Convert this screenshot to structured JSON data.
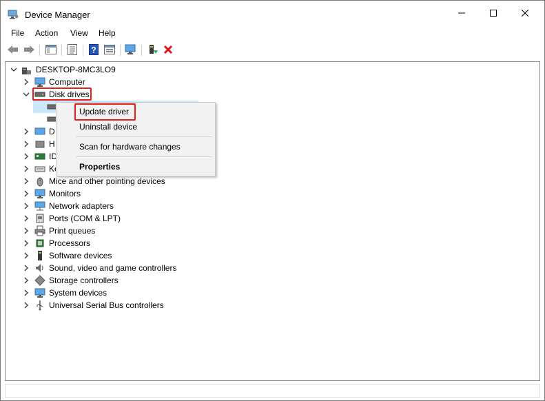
{
  "window": {
    "title": "Device Manager"
  },
  "window_controls": {
    "minimize": "minimize-icon",
    "maximize": "maximize-icon",
    "close": "close-icon"
  },
  "menu": [
    "File",
    "Action",
    "View",
    "Help"
  ],
  "toolbar": {
    "buttons": [
      "back-icon",
      "forward-icon",
      "show-hide-console-tree-icon",
      "properties-icon",
      "help-icon",
      "view-icon",
      "scan-hardware-icon",
      "update-driver-icon",
      "uninstall-icon"
    ]
  },
  "tree": {
    "root": "DESKTOP-8MC3LO9",
    "computer": "Computer",
    "disk_drives": "Disk drives",
    "partial": [
      "D",
      "H",
      "ID",
      "Ke"
    ],
    "categories": [
      "Mice and other pointing devices",
      "Monitors",
      "Network adapters",
      "Ports (COM & LPT)",
      "Print queues",
      "Processors",
      "Software devices",
      "Sound, video and game controllers",
      "Storage controllers",
      "System devices",
      "Universal Serial Bus controllers"
    ]
  },
  "context_menu": {
    "update_driver": "Update driver",
    "uninstall_device": "Uninstall device",
    "scan": "Scan for hardware changes",
    "properties": "Properties"
  },
  "colors": {
    "highlight": "#e5201c",
    "selection": "#cce8ff"
  }
}
